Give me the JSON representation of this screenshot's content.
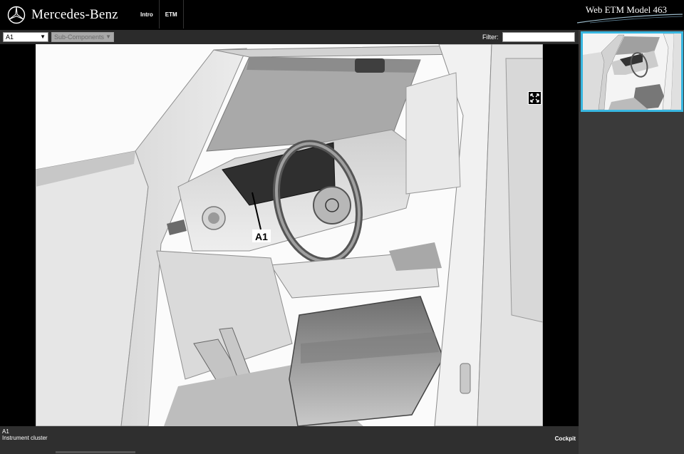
{
  "brand": {
    "name": "Mercedes-Benz",
    "logo_icon": "three-pointed-star-icon"
  },
  "nav": {
    "items": [
      {
        "label": "Intro"
      },
      {
        "label": "ETM"
      }
    ]
  },
  "app": {
    "title": "Web ETM Model 463"
  },
  "toolbar": {
    "component_select_value": "A1",
    "subcomponent_select_value": "Sub-Components",
    "filter_label": "Filter:",
    "filter_value": ""
  },
  "illustration": {
    "callout_label": "A1",
    "fullscreen_icon": "expand-icon"
  },
  "component_info": {
    "code": "A1",
    "name": "Instrument cluster",
    "location": "Cockpit"
  },
  "colors": {
    "header_bg": "#000000",
    "panel_bg": "#3a3a3a",
    "toolbar_bg": "#2b2b2b",
    "thumbnail_selected_border": "#38b6e0"
  }
}
